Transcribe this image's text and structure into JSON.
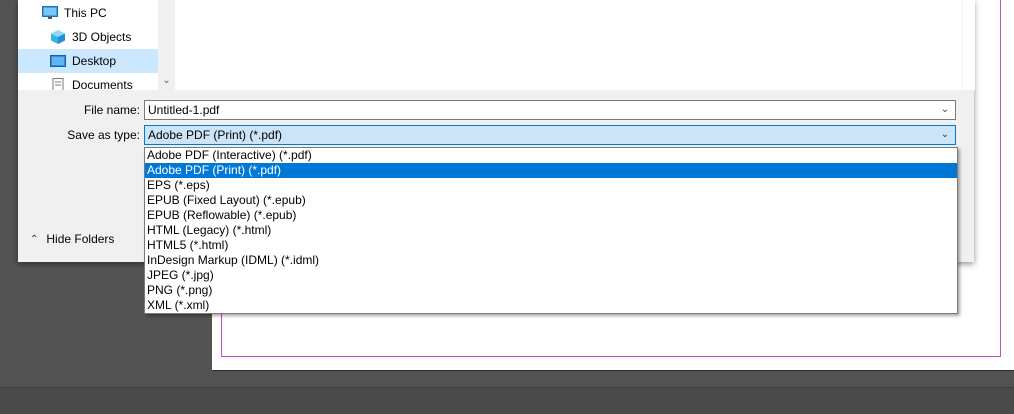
{
  "navigation": {
    "items": [
      {
        "label": "This PC",
        "icon": "computer-icon",
        "selected": false
      },
      {
        "label": "3D Objects",
        "icon": "cube-icon",
        "selected": false
      },
      {
        "label": "Desktop",
        "icon": "desktop-icon",
        "selected": true
      },
      {
        "label": "Documents",
        "icon": "document-icon",
        "selected": false
      }
    ]
  },
  "form": {
    "file_name_label": "File name:",
    "file_name_value": "Untitled-1.pdf",
    "save_type_label": "Save as type:",
    "save_type_value": "Adobe PDF (Print) (*.pdf)"
  },
  "hide_folders_label": "Hide Folders",
  "save_type_options": [
    "Adobe PDF (Interactive) (*.pdf)",
    "Adobe PDF (Print) (*.pdf)",
    "EPS (*.eps)",
    "EPUB (Fixed Layout) (*.epub)",
    "EPUB (Reflowable) (*.epub)",
    "HTML (Legacy) (*.html)",
    "HTML5 (*.html)",
    "InDesign Markup (IDML) (*.idml)",
    "JPEG (*.jpg)",
    "PNG (*.png)",
    "XML (*.xml)"
  ],
  "selected_option_index": 1,
  "colors": {
    "selection_blue": "#0078d7",
    "focus_highlight": "#cce4f7",
    "nav_selected": "#cce8ff",
    "margin_guide": "#c84fd0",
    "workspace": "#535353"
  }
}
